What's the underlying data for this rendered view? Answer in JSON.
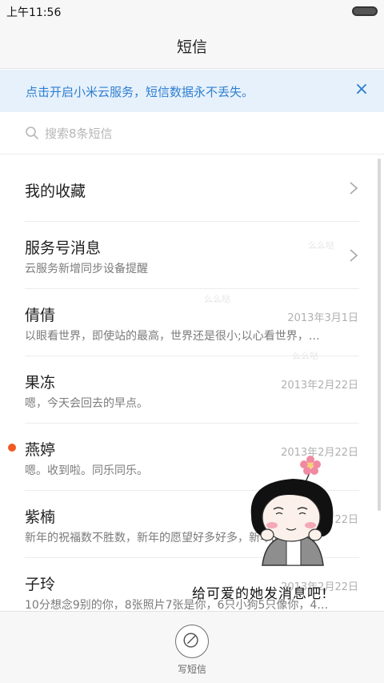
{
  "status_bar": {
    "time": "上午11:56"
  },
  "header": {
    "title": "短信"
  },
  "banner": {
    "text": "点击开启小米云服务，短信数据永不丢失。",
    "close_icon": "×"
  },
  "search": {
    "placeholder": "搜索8条短信",
    "value": ""
  },
  "conversations": [
    {
      "name": "我的收藏",
      "sub": "",
      "date": "",
      "chevron": true,
      "unread": false
    },
    {
      "name": "服务号消息",
      "sub": "云服务新增同步设备提醒",
      "date": "",
      "chevron": true,
      "unread": false
    },
    {
      "name": "倩倩",
      "sub": "以眼看世界，即使站的最高，世界还是很小;以心看世界，…",
      "date": "2013年3月1日",
      "chevron": false,
      "unread": false
    },
    {
      "name": "果冻",
      "sub": "嗯，今天会回去的早点。",
      "date": "2013年2月22日",
      "chevron": false,
      "unread": false
    },
    {
      "name": "燕婷",
      "sub": "嗯。收到啦。同乐同乐。",
      "date": "2013年2月22日",
      "chevron": false,
      "unread": true
    },
    {
      "name": "紫楠",
      "sub": "新年的祝福数不胜数，新年的愿望好多好多，新年的问候…",
      "date": "2013年2月22日",
      "chevron": false,
      "unread": false
    },
    {
      "name": "子玲",
      "sub": "10分想念9别的你，8张照片7张是你，6只小狗5只像你，4…",
      "date": "2013年2月22日",
      "chevron": false,
      "unread": false
    }
  ],
  "watermarks": [
    "么么哒",
    "么么哒",
    "么么哒"
  ],
  "sticker": {
    "caption": "给可爱的她发消息吧!"
  },
  "bottom": {
    "compose_label": "写短信"
  },
  "colors": {
    "accent": "#2e7fd0",
    "banner_bg": "#e7f1fb",
    "unread": "#f15a22"
  }
}
